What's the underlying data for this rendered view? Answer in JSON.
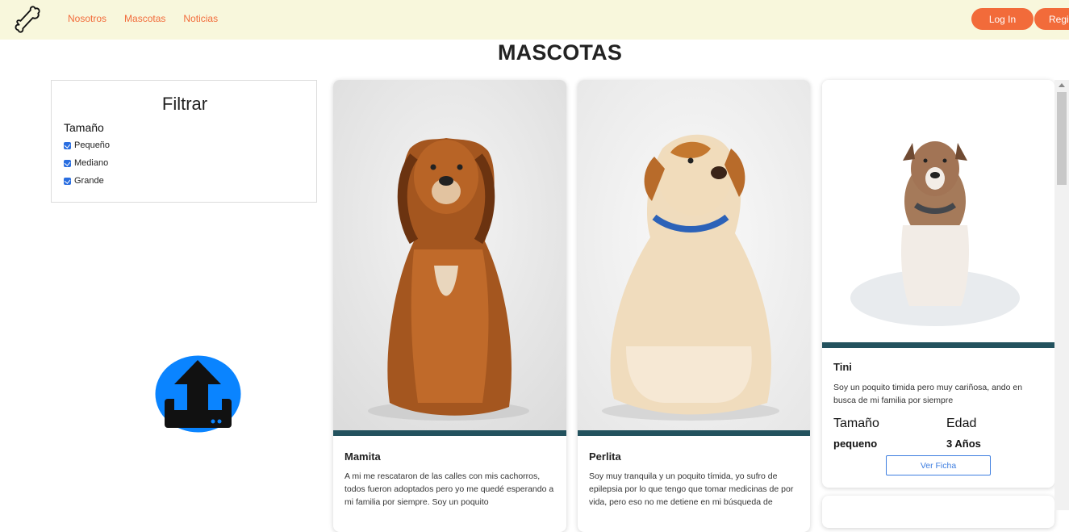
{
  "nav": {
    "links": [
      "Nosotros",
      "Mascotas",
      "Noticias"
    ],
    "login": "Log In",
    "register": "Registrarse"
  },
  "page": {
    "title": "MASCOTAS"
  },
  "filter": {
    "title": "Filtrar",
    "section": "Tamaño",
    "options": [
      "Pequeño",
      "Mediano",
      "Grande"
    ]
  },
  "pets": [
    {
      "name": "Mamita",
      "description": "A mi me rescataron de las calles con mis cachorros, todos fueron adoptados pero yo me quedé esperando a mi familia por siempre. Soy un poquito"
    },
    {
      "name": "Perlita",
      "description": "Soy muy tranquila y un poquito tímida, yo sufro de epilepsia por lo que tengo que tomar medicinas de por vida, pero eso no me detiene en mi búsqueda de"
    },
    {
      "name": "Tini",
      "description": "Soy un poquito timida pero muy cariñosa, ando en busca de mi familia por siempre",
      "size_label": "Tamaño",
      "size": "pequeno",
      "age_label": "Edad",
      "age": "3 Años",
      "button": "Ver Ficha"
    }
  ],
  "colors": {
    "accent": "#f26b3a",
    "nav_bg": "#f8f7dc",
    "card_bar": "#23525e",
    "upload_blue": "#0a84ff"
  },
  "icons": [
    "bone-logo-icon",
    "upload-icon",
    "checkbox-checked-icon"
  ]
}
